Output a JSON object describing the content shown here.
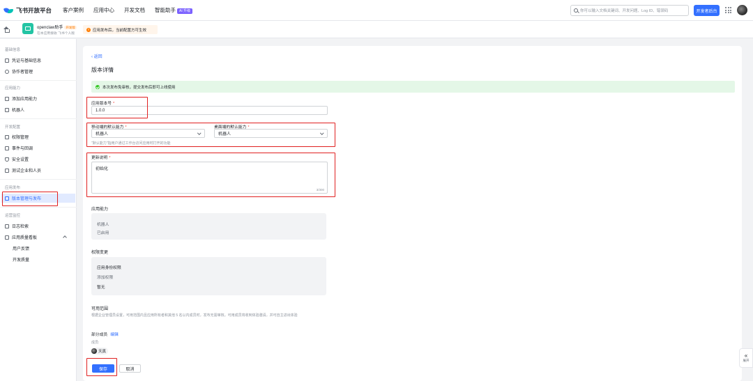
{
  "topnav": {
    "brand": "飞书开放平台",
    "links": [
      "客户案例",
      "应用中心",
      "开发文档",
      "智能助手"
    ],
    "ai_badge": "AI 升级",
    "search_placeholder": "你可以输入文档关键词、开发问题、Log ID、错误码",
    "dev_console": "开发者后台"
  },
  "app_header": {
    "app_name": "openclaw助手",
    "draft_badge": "开发版",
    "app_sub": "在本应用接收 飞书个人版",
    "notice": "应用发布后，当前配置方可生效"
  },
  "sidebar": {
    "sections": [
      {
        "title": "基础信息",
        "items": [
          "凭证与基础信息",
          "协作者管理"
        ]
      },
      {
        "title": "应用能力",
        "items": [
          "添加应用能力",
          "机器人"
        ]
      },
      {
        "title": "开发配置",
        "items": [
          "权限管理",
          "事件与回调",
          "安全设置",
          "测试企业和人员"
        ]
      },
      {
        "title": "应用发布",
        "items": [
          "版本管理与发布"
        ]
      },
      {
        "title": "运营监控",
        "items": [
          "日志检索",
          "应用质量看板"
        ]
      }
    ],
    "sub_items": [
      "用户反馈",
      "开发质量"
    ]
  },
  "main": {
    "back": "返回",
    "title": "版本详情",
    "success_msg": "本次发布免审核，提交发布后即可上线使用",
    "version_label": "应用版本号",
    "version_value": "1.0.0",
    "mobile_label": "移动端的默认能力",
    "mobile_value": "机器人",
    "desktop_label": "桌面端的默认能力",
    "desktop_value": "机器人",
    "default_hint": "\"默认能力\"指用户通过工作台访问应用时打开的功能",
    "notes_label": "更新说明",
    "notes_value": "初始化",
    "notes_counter": "3/300",
    "capability_title": "应用能力",
    "capability_items": [
      "机器人",
      "已启用"
    ],
    "perm_title": "权限变更",
    "perm_items": [
      "应用身份权限",
      "添加权限",
      "暂无"
    ],
    "scope_title": "可用范围",
    "scope_desc": "根据企业管理员设置，可用范围内且应用所有者和其他 5 名以内成员时，发布无需审核。可用成员将收到体验邀请，并可自主进出体验",
    "scope_member_label": "部分成员",
    "scope_edit": "编辑",
    "scope_members_caption": "成员:",
    "member_name": "天真",
    "save": "保存",
    "cancel": "取消"
  },
  "expand_label": "展开"
}
